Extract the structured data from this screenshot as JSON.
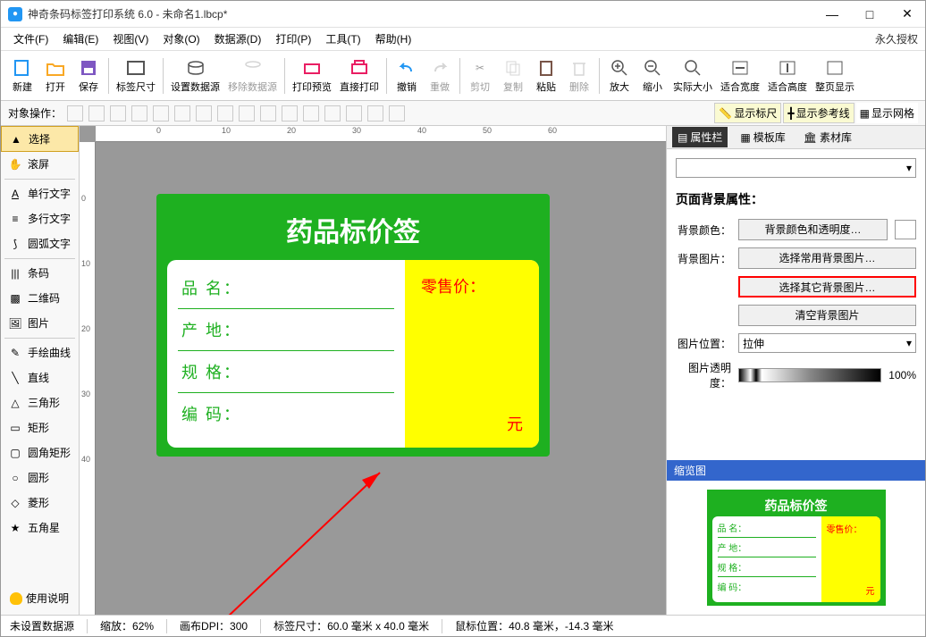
{
  "title": "神奇条码标签打印系统 6.0 - 未命名1.lbcp*",
  "license": "永久授权",
  "menus": [
    "文件(F)",
    "编辑(E)",
    "视图(V)",
    "对象(O)",
    "数据源(D)",
    "打印(P)",
    "工具(T)",
    "帮助(H)"
  ],
  "toolbar": [
    "新建",
    "打开",
    "保存",
    "标签尺寸",
    "设置数据源",
    "移除数据源",
    "打印预览",
    "直接打印",
    "撤销",
    "重做",
    "剪切",
    "复制",
    "粘贴",
    "删除",
    "放大",
    "缩小",
    "实际大小",
    "适合宽度",
    "适合高度",
    "整页显示"
  ],
  "obj_label": "对象操作：",
  "view_opts": {
    "ruler": "显示标尺",
    "guide": "显示参考线",
    "grid": "显示网格"
  },
  "left_tools": [
    "选择",
    "滚屏",
    "单行文字",
    "多行文字",
    "圆弧文字",
    "条码",
    "二维码",
    "图片",
    "手绘曲线",
    "直线",
    "三角形",
    "矩形",
    "圆角矩形",
    "圆形",
    "菱形",
    "五角星"
  ],
  "help_text": "使用说明",
  "ruler_h": [
    "0",
    "10",
    "20",
    "30",
    "40",
    "50",
    "60"
  ],
  "ruler_v": [
    "0",
    "10",
    "20",
    "30",
    "40"
  ],
  "card": {
    "title": "药品标价签",
    "rows": [
      "品 名：",
      "产 地：",
      "规 格：",
      "编 码："
    ],
    "price_label": "零售价：",
    "yuan": "元"
  },
  "panel": {
    "tabs": [
      "属性栏",
      "模板库",
      "素材库"
    ],
    "section": "页面背景属性：",
    "bg_color_label": "背景颜色：",
    "bg_color_btn": "背景颜色和透明度…",
    "bg_img_label": "背景图片：",
    "btn_common": "选择常用背景图片…",
    "btn_other": "选择其它背景图片…",
    "btn_clear": "清空背景图片",
    "img_pos_label": "图片位置：",
    "img_pos_val": "拉伸",
    "opacity_label": "图片透明度：",
    "opacity_val": "100%",
    "preview": "缩览图"
  },
  "status": {
    "datasource": "未设置数据源",
    "zoom": "缩放：62%",
    "dpi": "画布DPI：300",
    "size": "标签尺寸：60.0 毫米 x 40.0 毫米",
    "mouse": "鼠标位置：40.8 毫米，-14.3 毫米"
  }
}
